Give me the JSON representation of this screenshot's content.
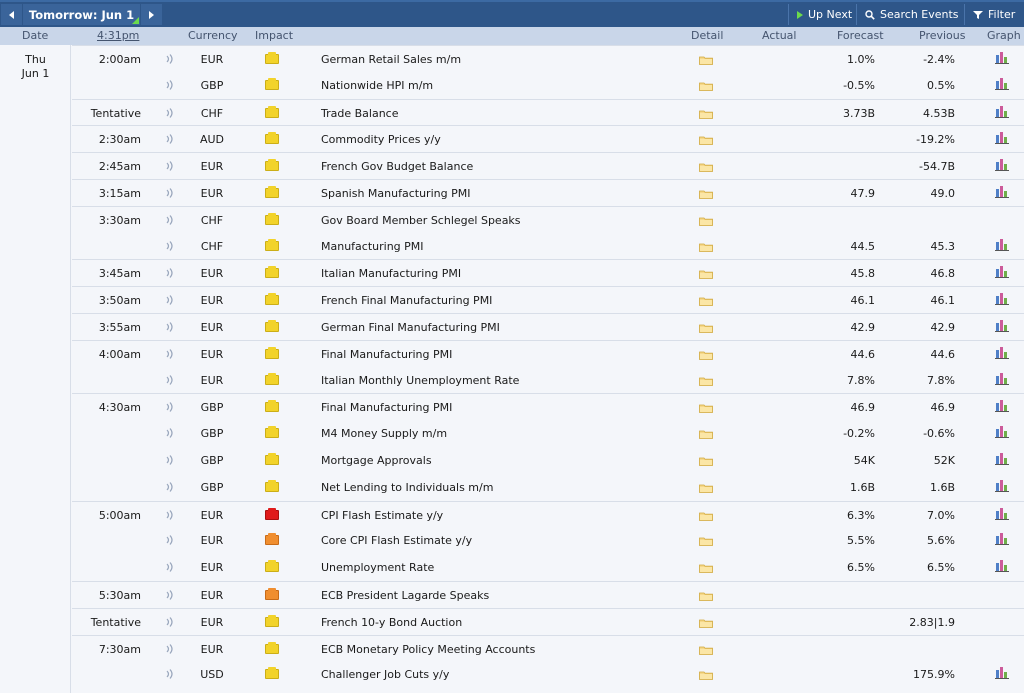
{
  "nav": {
    "prev_arrow": "prev-arrow-icon",
    "current_day": "Tomorrow: Jun 1",
    "next_arrow": "next-arrow-icon",
    "up_next": "Up Next",
    "search_events": "Search Events",
    "filter": "Filter"
  },
  "columns": {
    "date": "Date",
    "time": "4:31pm",
    "currency": "Currency",
    "impact": "Impact",
    "detail": "Detail",
    "actual": "Actual",
    "forecast": "Forecast",
    "previous": "Previous",
    "graph": "Graph"
  },
  "day": {
    "weekday": "Thu",
    "date": "Jun 1"
  },
  "colors": {
    "topbar": "#2e5689",
    "header": "#c9d6e9",
    "impact_low": "#f2d32a",
    "impact_medium": "#f08e2f",
    "impact_high": "#e01b1b"
  },
  "events": [
    {
      "time": "2:00am",
      "currency": "EUR",
      "impact": "low",
      "event": "German Retail Sales m/m",
      "forecast": "1.0%",
      "previous": "-2.4%",
      "graph": true
    },
    {
      "time": "",
      "currency": "GBP",
      "impact": "low",
      "event": "Nationwide HPI m/m",
      "forecast": "-0.5%",
      "previous": "0.5%",
      "graph": true
    },
    {
      "time": "Tentative",
      "currency": "CHF",
      "impact": "low",
      "event": "Trade Balance",
      "forecast": "3.73B",
      "previous": "4.53B",
      "graph": true
    },
    {
      "time": "2:30am",
      "currency": "AUD",
      "impact": "low",
      "event": "Commodity Prices y/y",
      "forecast": "",
      "previous": "-19.2%",
      "graph": true
    },
    {
      "time": "2:45am",
      "currency": "EUR",
      "impact": "low",
      "event": "French Gov Budget Balance",
      "forecast": "",
      "previous": "-54.7B",
      "graph": true
    },
    {
      "time": "3:15am",
      "currency": "EUR",
      "impact": "low",
      "event": "Spanish Manufacturing PMI",
      "forecast": "47.9",
      "previous": "49.0",
      "graph": true
    },
    {
      "time": "3:30am",
      "currency": "CHF",
      "impact": "low",
      "event": "Gov Board Member Schlegel Speaks",
      "forecast": "",
      "previous": "",
      "graph": false
    },
    {
      "time": "",
      "currency": "CHF",
      "impact": "low",
      "event": "Manufacturing PMI",
      "forecast": "44.5",
      "previous": "45.3",
      "graph": true
    },
    {
      "time": "3:45am",
      "currency": "EUR",
      "impact": "low",
      "event": "Italian Manufacturing PMI",
      "forecast": "45.8",
      "previous": "46.8",
      "graph": true
    },
    {
      "time": "3:50am",
      "currency": "EUR",
      "impact": "low",
      "event": "French Final Manufacturing PMI",
      "forecast": "46.1",
      "previous": "46.1",
      "graph": true
    },
    {
      "time": "3:55am",
      "currency": "EUR",
      "impact": "low",
      "event": "German Final Manufacturing PMI",
      "forecast": "42.9",
      "previous": "42.9",
      "graph": true
    },
    {
      "time": "4:00am",
      "currency": "EUR",
      "impact": "low",
      "event": "Final Manufacturing PMI",
      "forecast": "44.6",
      "previous": "44.6",
      "graph": true
    },
    {
      "time": "",
      "currency": "EUR",
      "impact": "low",
      "event": "Italian Monthly Unemployment Rate",
      "forecast": "7.8%",
      "previous": "7.8%",
      "graph": true
    },
    {
      "time": "4:30am",
      "currency": "GBP",
      "impact": "low",
      "event": "Final Manufacturing PMI",
      "forecast": "46.9",
      "previous": "46.9",
      "graph": true
    },
    {
      "time": "",
      "currency": "GBP",
      "impact": "low",
      "event": "M4 Money Supply m/m",
      "forecast": "-0.2%",
      "previous": "-0.6%",
      "graph": true
    },
    {
      "time": "",
      "currency": "GBP",
      "impact": "low",
      "event": "Mortgage Approvals",
      "forecast": "54K",
      "previous": "52K",
      "graph": true
    },
    {
      "time": "",
      "currency": "GBP",
      "impact": "low",
      "event": "Net Lending to Individuals m/m",
      "forecast": "1.6B",
      "previous": "1.6B",
      "graph": true
    },
    {
      "time": "5:00am",
      "currency": "EUR",
      "impact": "high",
      "event": "CPI Flash Estimate y/y",
      "forecast": "6.3%",
      "previous": "7.0%",
      "graph": true
    },
    {
      "time": "",
      "currency": "EUR",
      "impact": "medium",
      "event": "Core CPI Flash Estimate y/y",
      "forecast": "5.5%",
      "previous": "5.6%",
      "graph": true
    },
    {
      "time": "",
      "currency": "EUR",
      "impact": "low",
      "event": "Unemployment Rate",
      "forecast": "6.5%",
      "previous": "6.5%",
      "graph": true
    },
    {
      "time": "5:30am",
      "currency": "EUR",
      "impact": "medium",
      "event": "ECB President Lagarde Speaks",
      "forecast": "",
      "previous": "",
      "graph": false
    },
    {
      "time": "Tentative",
      "currency": "EUR",
      "impact": "low",
      "event": "French 10-y Bond Auction",
      "forecast": "",
      "previous": "2.83|1.9",
      "graph": false
    },
    {
      "time": "7:30am",
      "currency": "EUR",
      "impact": "low",
      "event": "ECB Monetary Policy Meeting Accounts",
      "forecast": "",
      "previous": "",
      "graph": false
    },
    {
      "time": "",
      "currency": "USD",
      "impact": "low",
      "event": "Challenger Job Cuts y/y",
      "forecast": "",
      "previous": "175.9%",
      "graph": true
    }
  ]
}
